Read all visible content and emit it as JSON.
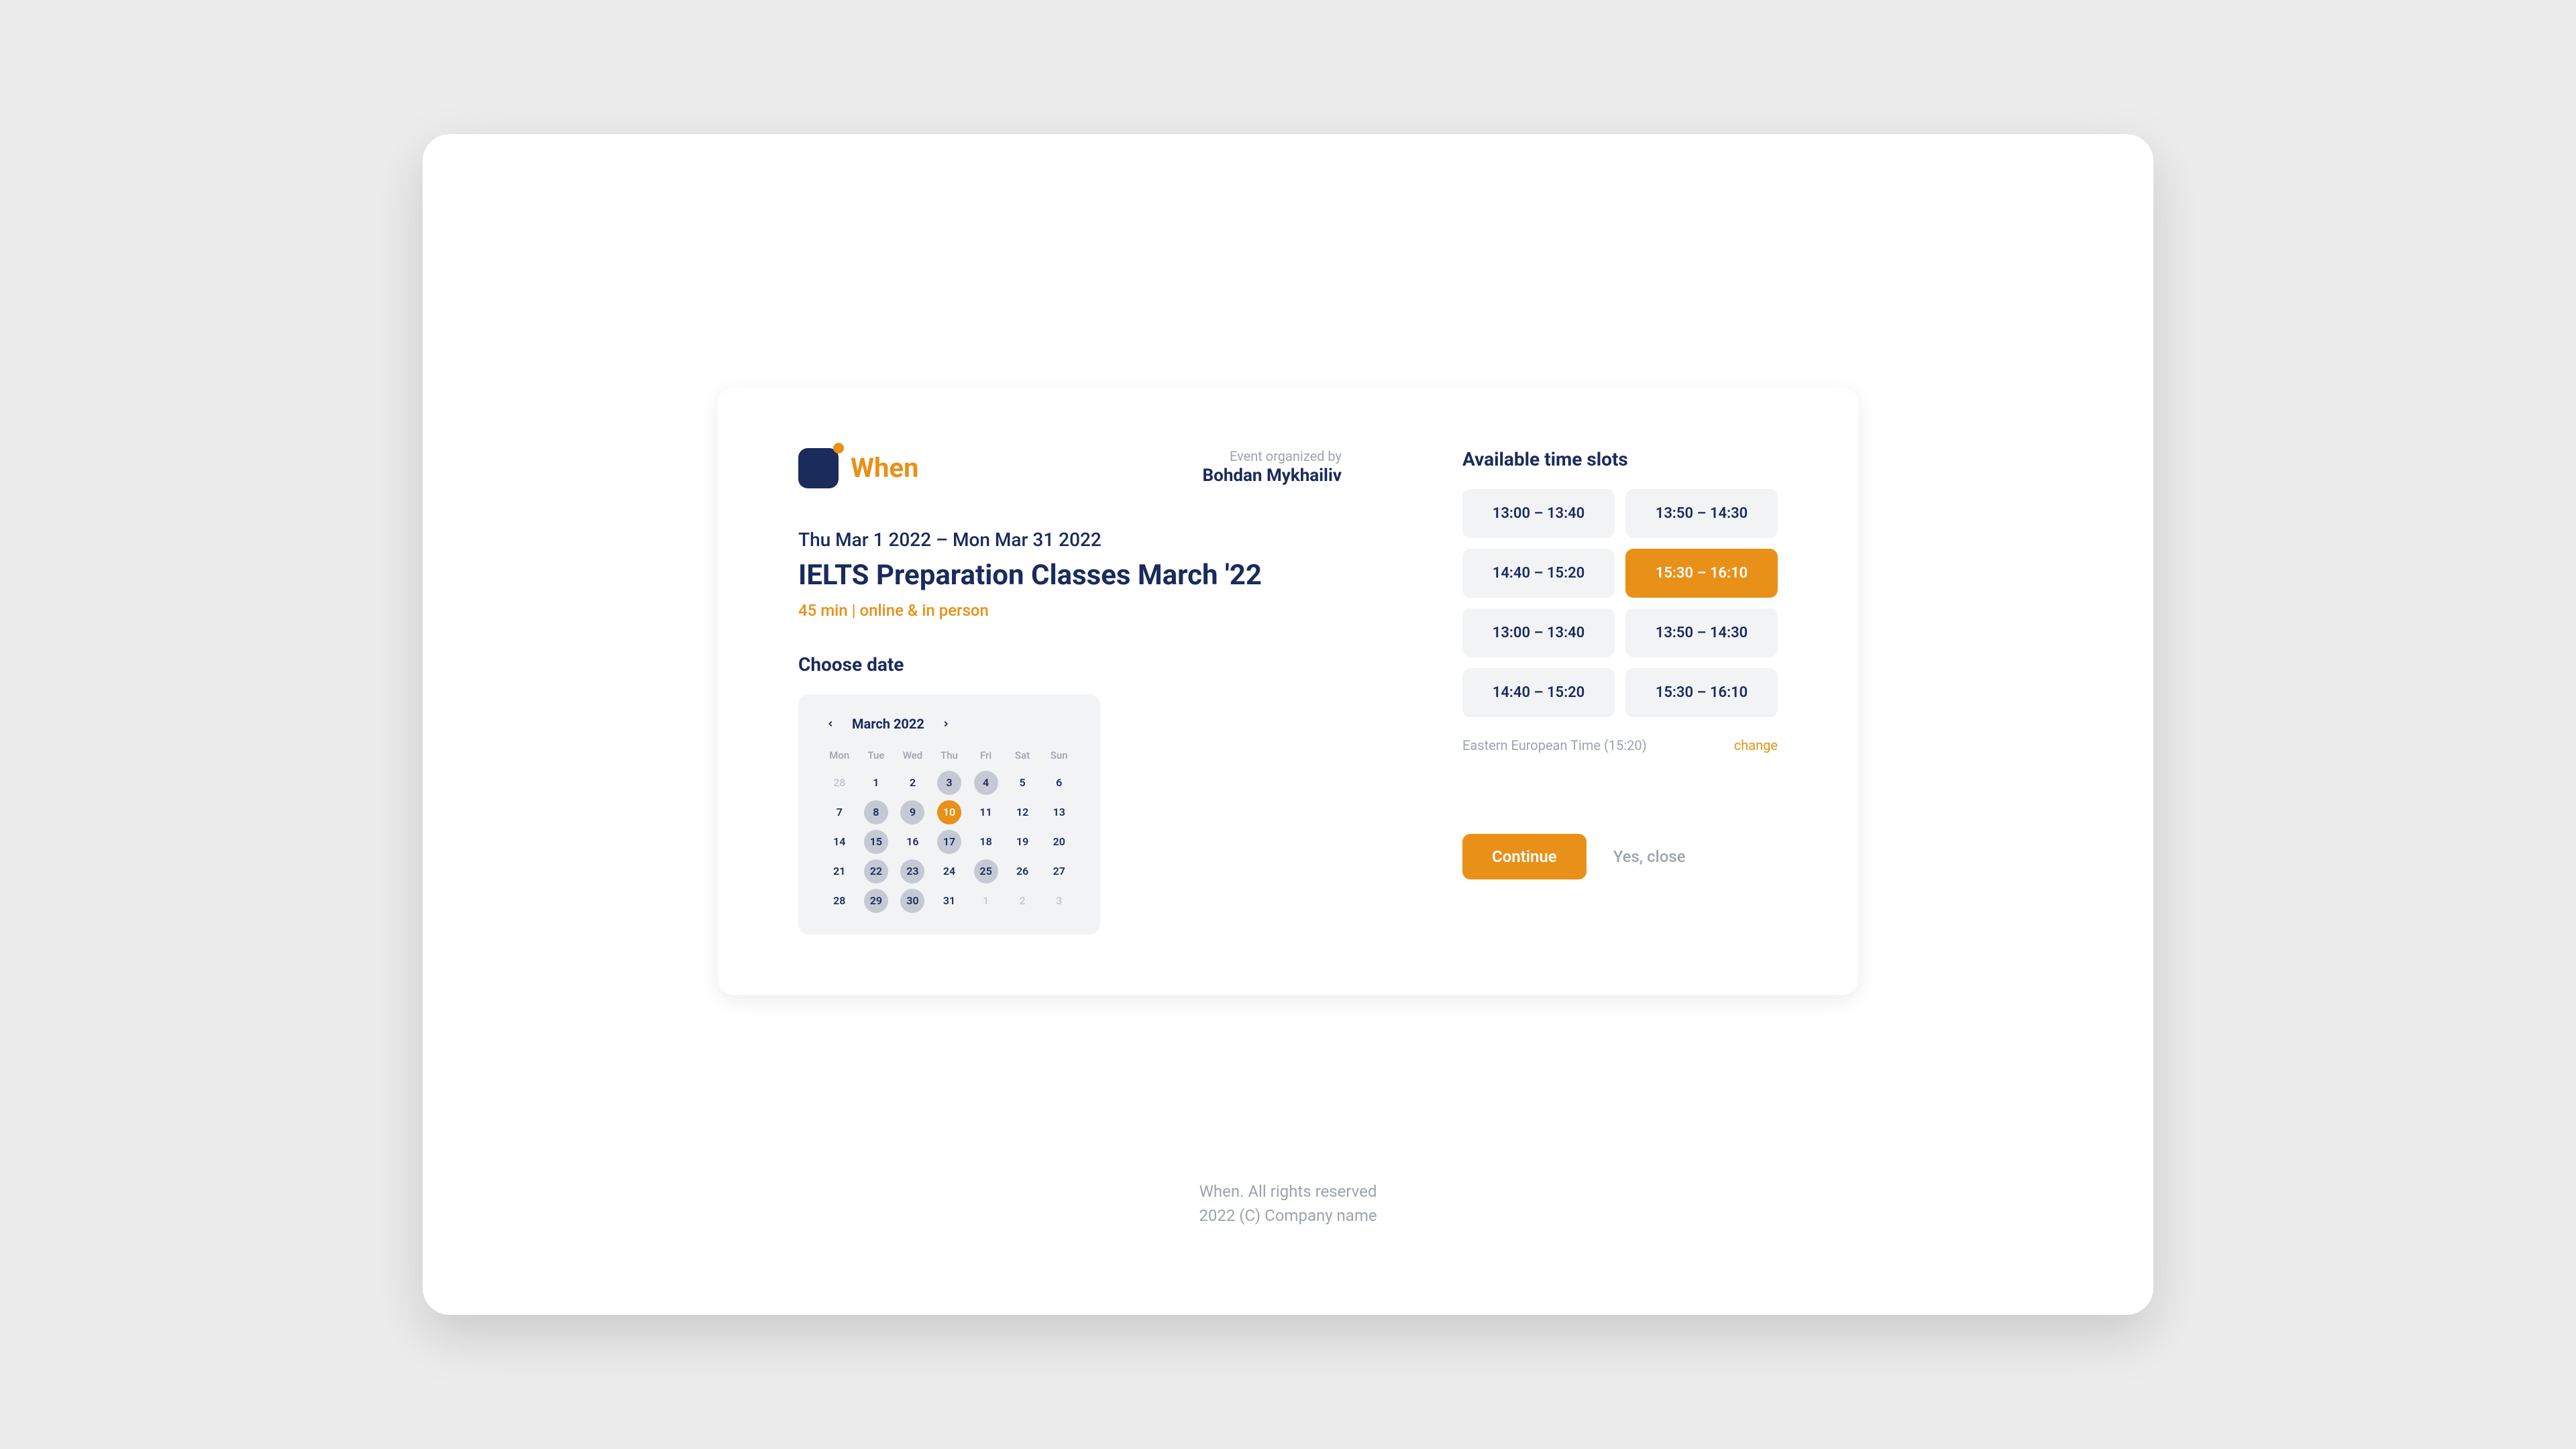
{
  "brand": {
    "name": "When"
  },
  "organizer": {
    "label": "Event organized by",
    "name": "Bohdan Mykhailiv"
  },
  "event": {
    "date_range": "Thu Mar 1 2022 – Mon Mar 31 2022",
    "title": "IELTS Preparation Classes March '22",
    "meta": "45 min | online & in person"
  },
  "calendar": {
    "label": "Choose date",
    "month": "March 2022",
    "dows": [
      "Mon",
      "Tue",
      "Wed",
      "Thu",
      "Fri",
      "Sat",
      "Sun"
    ],
    "days": [
      {
        "n": "28",
        "state": "muted"
      },
      {
        "n": "1",
        "state": "normal"
      },
      {
        "n": "2",
        "state": "normal"
      },
      {
        "n": "3",
        "state": "chip"
      },
      {
        "n": "4",
        "state": "chip"
      },
      {
        "n": "5",
        "state": "normal"
      },
      {
        "n": "6",
        "state": "normal"
      },
      {
        "n": "7",
        "state": "normal"
      },
      {
        "n": "8",
        "state": "chip"
      },
      {
        "n": "9",
        "state": "chip"
      },
      {
        "n": "10",
        "state": "selected"
      },
      {
        "n": "11",
        "state": "normal"
      },
      {
        "n": "12",
        "state": "normal"
      },
      {
        "n": "13",
        "state": "normal"
      },
      {
        "n": "14",
        "state": "normal"
      },
      {
        "n": "15",
        "state": "chip"
      },
      {
        "n": "16",
        "state": "normal"
      },
      {
        "n": "17",
        "state": "chip"
      },
      {
        "n": "18",
        "state": "normal"
      },
      {
        "n": "19",
        "state": "normal"
      },
      {
        "n": "20",
        "state": "normal"
      },
      {
        "n": "21",
        "state": "normal"
      },
      {
        "n": "22",
        "state": "chip"
      },
      {
        "n": "23",
        "state": "chip"
      },
      {
        "n": "24",
        "state": "normal"
      },
      {
        "n": "25",
        "state": "chip"
      },
      {
        "n": "26",
        "state": "normal"
      },
      {
        "n": "27",
        "state": "normal"
      },
      {
        "n": "28",
        "state": "normal"
      },
      {
        "n": "29",
        "state": "chip"
      },
      {
        "n": "30",
        "state": "chip"
      },
      {
        "n": "31",
        "state": "normal"
      },
      {
        "n": "1",
        "state": "muted"
      },
      {
        "n": "2",
        "state": "muted"
      },
      {
        "n": "3",
        "state": "muted"
      }
    ]
  },
  "slots": {
    "label": "Available time slots",
    "items": [
      {
        "text": "13:00 – 13:40",
        "selected": false
      },
      {
        "text": "13:50 – 14:30",
        "selected": false
      },
      {
        "text": "14:40 – 15:20",
        "selected": false
      },
      {
        "text": "15:30 – 16:10",
        "selected": true
      },
      {
        "text": "13:00 – 13:40",
        "selected": false
      },
      {
        "text": "13:50 – 14:30",
        "selected": false
      },
      {
        "text": "14:40 – 15:20",
        "selected": false
      },
      {
        "text": "15:30 – 16:10",
        "selected": false
      }
    ],
    "timezone": "Eastern European Time (15:20)",
    "change_label": "change"
  },
  "actions": {
    "continue": "Continue",
    "close": "Yes, close"
  },
  "footer": {
    "line1": "When. All rights reserved",
    "line2": "2022 (C) Company name"
  }
}
